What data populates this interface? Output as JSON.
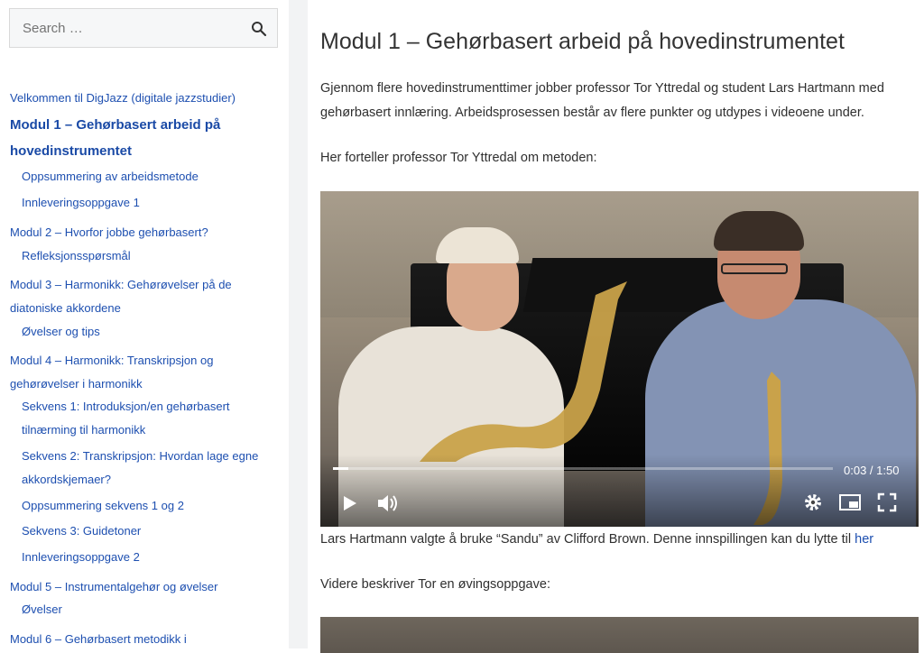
{
  "search": {
    "placeholder": "Search …"
  },
  "sidebar": {
    "items": [
      {
        "label": "Velkommen til DigJazz (digitale jazzstudier)"
      },
      {
        "label": "Modul 1 – Gehørbasert arbeid på",
        "label2": "hovedinstrumentet"
      },
      {
        "label": "Oppsummering av arbeidsmetode"
      },
      {
        "label": "Innleveringsoppgave 1"
      },
      {
        "label": "Modul 2 – Hvorfor jobbe gehørbasert?"
      },
      {
        "label": "Refleksjonsspørsmål"
      },
      {
        "label": "Modul 3 – Harmonikk: Gehørøvelser på de",
        "label2": "diatoniske akkordene"
      },
      {
        "label": "Øvelser og tips"
      },
      {
        "label": "Modul 4 – Harmonikk: Transkripsjon og",
        "label2": "gehørøvelser i harmonikk"
      },
      {
        "label": "Sekvens 1: Introduksjon/en gehørbasert",
        "label2": "tilnærming til harmonikk"
      },
      {
        "label": "Sekvens 2: Transkripsjon: Hvordan lage egne",
        "label2": "akkordskjemaer?"
      },
      {
        "label": "Oppsummering sekvens 1 og 2"
      },
      {
        "label": "Sekvens 3: Guidetoner"
      },
      {
        "label": "Innleveringsoppgave 2"
      },
      {
        "label": "Modul 5 – Instrumentalgehør og øvelser"
      },
      {
        "label": "Øvelser"
      },
      {
        "label": "Modul 6 – Gehørbasert metodikk i"
      }
    ]
  },
  "main": {
    "title": "Modul 1 – Gehørbasert arbeid på hovedinstrumentet",
    "intro_line1": "Gjennom flere hovedinstrumenttimer jobber professor Tor Yttredal og student Lars Hartmann med",
    "intro_line2": "gehørbasert innlæring. Arbeidsprosessen består av flere punkter og utdypes i videoene under.",
    "lead": "Her forteller professor Tor Yttredal om metoden:",
    "video": {
      "time": "0:03 / 1:50",
      "progress": 0.03,
      "icons": [
        "play-icon",
        "volume-icon",
        "settings-icon",
        "picture-in-picture-icon",
        "fullscreen-icon"
      ]
    },
    "caption_text": "Lars Hartmann valgte å bruke  “Sandu” av Clifford Brown. Denne innspillingen kan du lytte til ",
    "caption_link": "her",
    "next_lead": "Videre beskriver Tor en øvingsoppgave:"
  },
  "colors": {
    "link": "#1d4fb0",
    "gutter": "#f2f3f4",
    "text": "#2f2f2f"
  }
}
